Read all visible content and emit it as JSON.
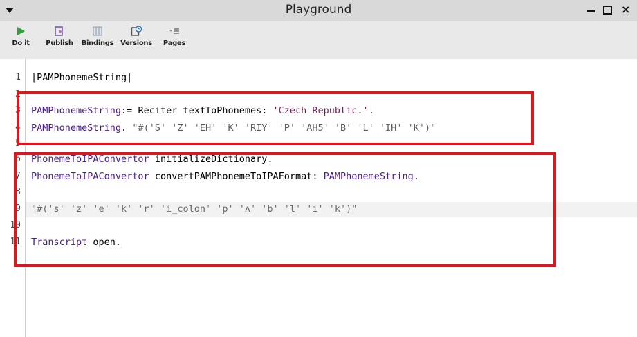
{
  "window": {
    "title": "Playground"
  },
  "toolbar": {
    "buttons": [
      {
        "label": "Do it",
        "icon": "play-icon"
      },
      {
        "label": "Publish",
        "icon": "publish-icon"
      },
      {
        "label": "Bindings",
        "icon": "bindings-icon"
      },
      {
        "label": "Versions",
        "icon": "versions-icon"
      },
      {
        "label": "Pages",
        "icon": "pages-icon"
      }
    ]
  },
  "editor": {
    "line_numbers": [
      "1",
      "2",
      "3",
      "4",
      "5",
      "6",
      "7",
      "8",
      "9",
      "10",
      "11"
    ],
    "lines": [
      {
        "parts": [
          "|PAMPhonemeString|"
        ]
      },
      {
        "parts": []
      },
      {
        "parts": [
          "PAMPhonemeString",
          ":= ",
          "Reciter",
          " textToPhonemes: ",
          "'Czech Republic.'",
          "."
        ]
      },
      {
        "parts": [
          "PAMPhonemeString",
          ". ",
          "\"#('S' 'Z' 'EH' 'K' 'RIY' 'P' 'AH5' 'B' 'L' 'IH' 'K')\""
        ]
      },
      {
        "parts": []
      },
      {
        "parts": [
          "PhonemeToIPAConvertor",
          " initializeDictionary."
        ]
      },
      {
        "parts": [
          "PhonemeToIPAConvertor",
          " convertPAMPhonemeToIPAFormat: ",
          "PAMPhonemeString",
          "."
        ]
      },
      {
        "parts": []
      },
      {
        "parts": [
          "\"#('s' 'z' 'e' 'k' 'r' 'i_colon' 'p' 'ʌ' 'b' 'l' 'i' 'k')\""
        ]
      },
      {
        "parts": []
      },
      {
        "parts": [
          "Transcript",
          " open."
        ]
      }
    ]
  },
  "colors": {
    "annotation_red": "#e0141c",
    "variable_purple": "#4a1d8c",
    "string_maroon": "#7a1b5b",
    "comment_gray": "#5c5c5c",
    "do_it_green": "#2aa532"
  }
}
